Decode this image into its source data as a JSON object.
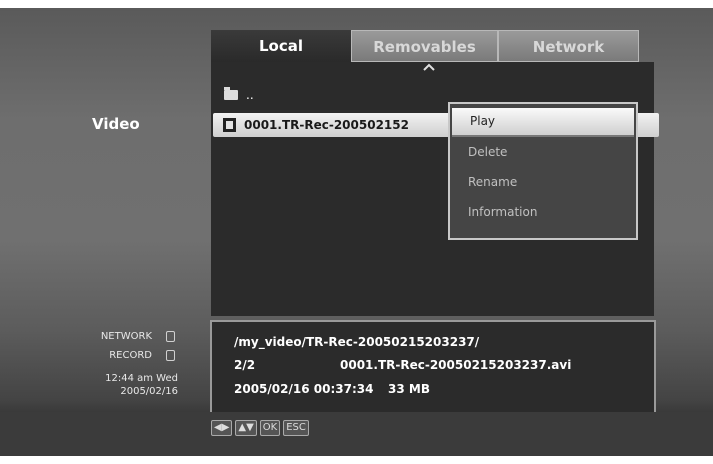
{
  "section": {
    "title": "Video"
  },
  "tabs": [
    {
      "label": "Local",
      "active": true
    },
    {
      "label": "Removables",
      "active": false
    },
    {
      "label": "Network",
      "active": false
    }
  ],
  "file_list": {
    "parent_label": "..",
    "items": [
      {
        "name": "0001.TR-Rec-200502152",
        "icon": "film-icon",
        "selected": true
      }
    ]
  },
  "context_menu": {
    "items": [
      {
        "label": "Play",
        "selected": true
      },
      {
        "label": "Delete",
        "selected": false
      },
      {
        "label": "Rename",
        "selected": false
      },
      {
        "label": "Information",
        "selected": false
      }
    ]
  },
  "status": {
    "network_label": "NETWORK",
    "record_label": "RECORD",
    "time": "12:44 am Wed",
    "date": "2005/02/16"
  },
  "info": {
    "path": "/my_video/TR-Rec-20050215203237/",
    "count": "2/2",
    "filename": "0001.TR-Rec-20050215203237.avi",
    "datetime": "2005/02/16 00:37:34",
    "size": "33 MB"
  },
  "keys": [
    {
      "label": "◀▶",
      "icon": "left-right-arrows-icon"
    },
    {
      "label": "▲▼",
      "icon": "up-down-arrows-icon"
    },
    {
      "label": "OK",
      "icon": "ok-key"
    },
    {
      "label": "ESC",
      "icon": "esc-key"
    }
  ],
  "colors": {
    "panel": "#2b2b2b",
    "highlight": "#f2f2f2",
    "background": "#6e6e6e"
  }
}
